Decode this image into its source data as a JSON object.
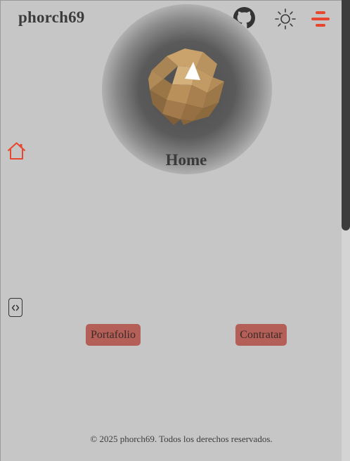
{
  "header": {
    "site_title": "phorch69",
    "icons": [
      "github-icon",
      "sun-icon",
      "hamburger-menu-icon"
    ]
  },
  "hero": {
    "page_title": "Home",
    "graphic": "low-poly-globe"
  },
  "sidebar": {
    "items": [
      {
        "icon": "home-icon",
        "active": true
      },
      {
        "icon": "code-icon",
        "active": false
      }
    ]
  },
  "actions": {
    "portfolio_label": "Portafolio",
    "hire_label": "Contratar"
  },
  "footer": {
    "text": "© 2025 phorch69. Todos los derechos reservados."
  },
  "colors": {
    "background": "#c6c6c6",
    "accent": "#e8462e",
    "button": "#b45f57",
    "text": "#3c3c3c",
    "scrollbar_thumb": "#3c3c3c"
  }
}
